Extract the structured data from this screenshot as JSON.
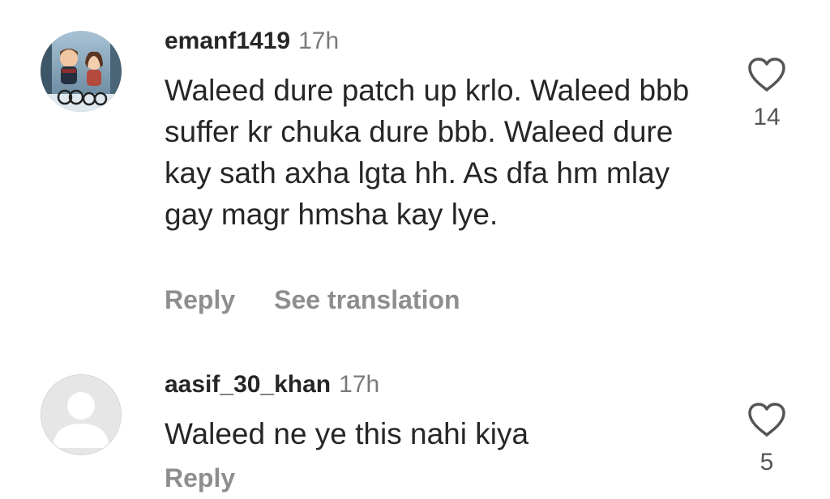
{
  "comments": [
    {
      "username": "emanf1419",
      "time": "17h",
      "text": "Waleed dure patch up krlo. Waleed bbb suffer kr chuka dure bbb. Waleed dure kay sath axha lgta hh. As dfa hm mlay gay magr hmsha kay lye.",
      "reply_label": "Reply",
      "translation_label": "See translation",
      "likes": "14",
      "avatar_icon": "cartoon-couple-avatar"
    },
    {
      "username": "aasif_30_khan",
      "time": "17h",
      "text": "Waleed ne ye this nahi kiya",
      "reply_label": "Reply",
      "likes": "5",
      "avatar_icon": "default-user-avatar"
    }
  ],
  "colors": {
    "text": "#262626",
    "muted": "#8e8e8e",
    "timestamp": "#7a7a7a"
  }
}
